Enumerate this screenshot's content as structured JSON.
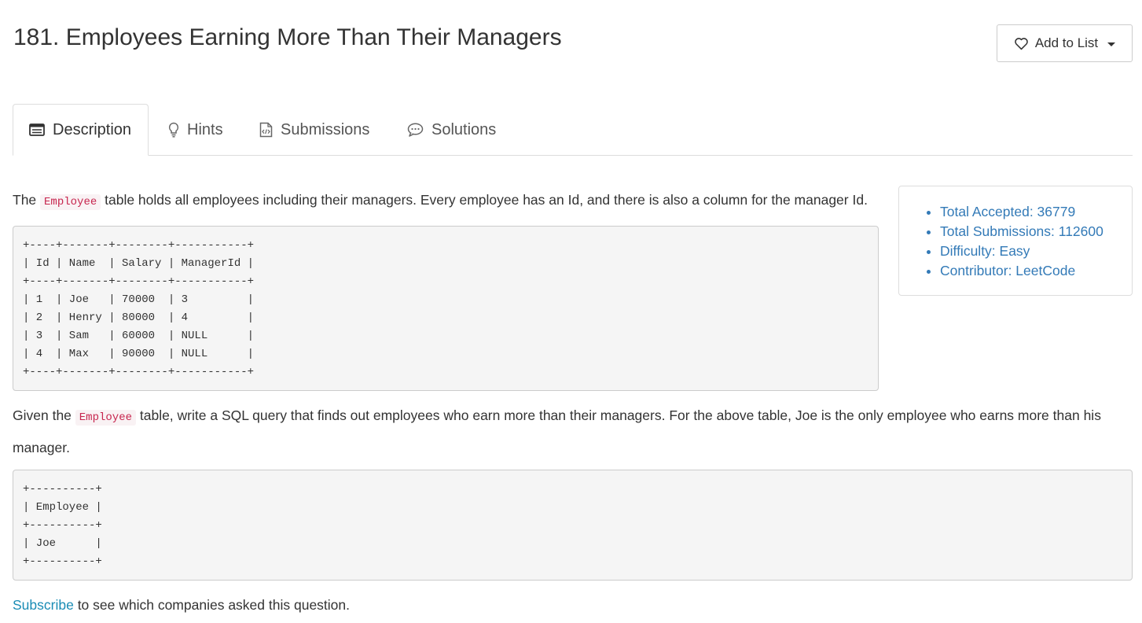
{
  "title": "181. Employees Earning More Than Their Managers",
  "add_to_list": {
    "label": "Add to List"
  },
  "tabs": [
    {
      "label": "Description",
      "icon": "list-icon",
      "active": true
    },
    {
      "label": "Hints",
      "icon": "lightbulb-icon",
      "active": false
    },
    {
      "label": "Submissions",
      "icon": "code-file-icon",
      "active": false
    },
    {
      "label": "Solutions",
      "icon": "chat-bubble-icon",
      "active": false
    }
  ],
  "description": {
    "p1_before": "The ",
    "p1_code": "Employee",
    "p1_after": " table holds all employees including their managers. Every employee has an Id, and there is also a column for the manager Id.",
    "table1": "+----+-------+--------+-----------+\n| Id | Name  | Salary | ManagerId |\n+----+-------+--------+-----------+\n| 1  | Joe   | 70000  | 3         |\n| 2  | Henry | 80000  | 4         |\n| 3  | Sam   | 60000  | NULL      |\n| 4  | Max   | 90000  | NULL      |\n+----+-------+--------+-----------+",
    "p2_before": "Given the ",
    "p2_code": "Employee",
    "p2_after": " table, write a SQL query that finds out employees who earn more than their managers. For the above table, Joe is the only employee who earns more than his manager.",
    "table2": "+----------+\n| Employee |\n+----------+\n| Joe      |\n+----------+",
    "subscribe_link": "Subscribe",
    "subscribe_after": " to see which companies asked this question."
  },
  "stats": [
    "Total Accepted: 36779",
    "Total Submissions: 112600",
    "Difficulty: Easy",
    "Contributor: LeetCode"
  ],
  "colors": {
    "link": "#337ab7",
    "subscribe": "#1a8cb5",
    "code_text": "#c7254e",
    "code_bg": "#f9f2f4"
  }
}
